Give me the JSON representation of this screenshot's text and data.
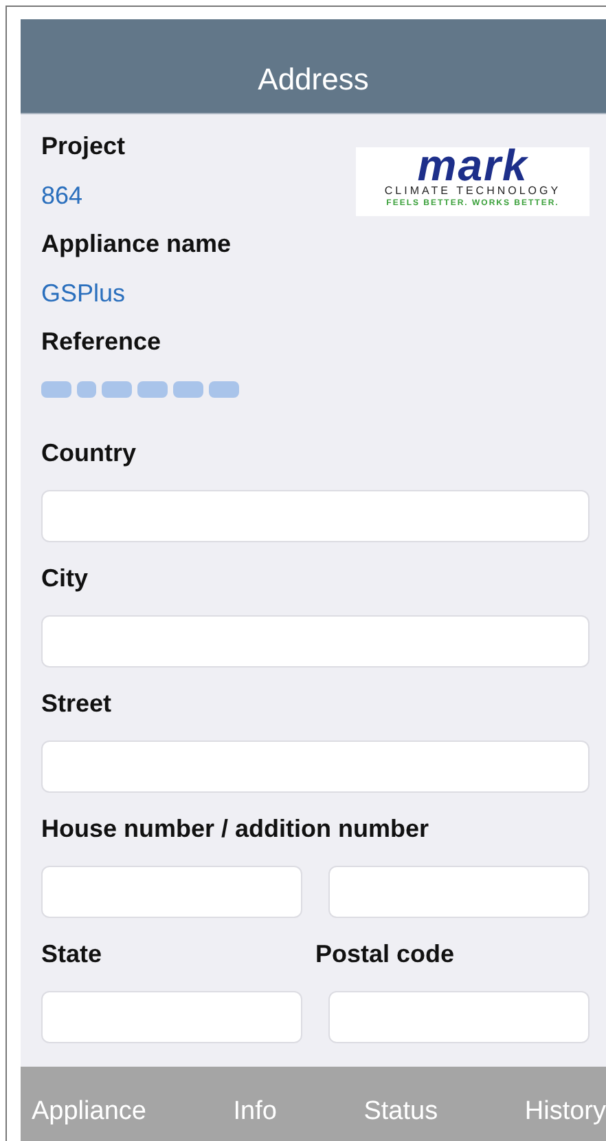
{
  "header": {
    "title": "Address"
  },
  "logo": {
    "wordmark": "mark",
    "line_1": "CLIMATE TECHNOLOGY",
    "line_2": "FEELS BETTER. WORKS BETTER."
  },
  "info": [
    {
      "label": "Project",
      "value": "864",
      "redacted": false
    },
    {
      "label": "Appliance name",
      "value": "GSPlus",
      "redacted": false
    },
    {
      "label": "Reference",
      "redacted": true
    }
  ],
  "fields": [
    {
      "kind": "single",
      "labels": [
        "Country"
      ]
    },
    {
      "kind": "single",
      "labels": [
        "City"
      ]
    },
    {
      "kind": "single",
      "labels": [
        "Street"
      ]
    },
    {
      "kind": "pair",
      "labels": [
        "House number / addition number"
      ]
    },
    {
      "kind": "pair",
      "labels": [
        "State",
        "Postal code"
      ]
    }
  ],
  "tabs": [
    {
      "label": "Appliance"
    },
    {
      "label": "Info"
    },
    {
      "label": "Status"
    },
    {
      "label": "History"
    }
  ]
}
